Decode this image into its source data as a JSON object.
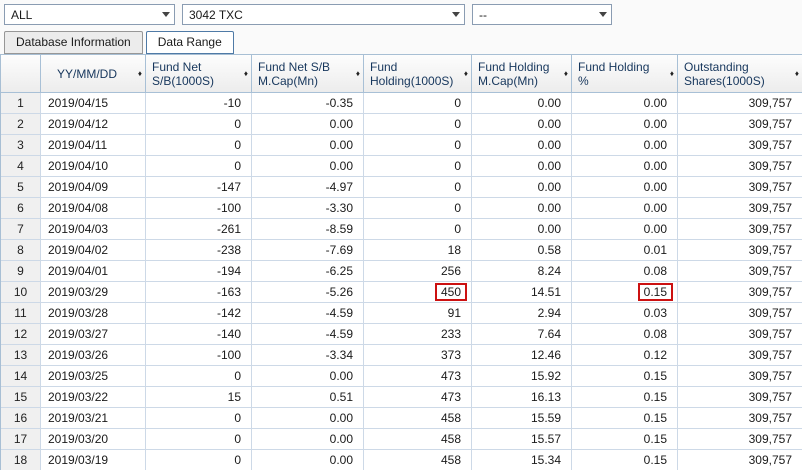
{
  "filters": {
    "dropdowns": [
      {
        "key": "market-filter",
        "value": "ALL"
      },
      {
        "key": "security-filter",
        "value": "3042 TXC"
      },
      {
        "key": "extra-filter",
        "value": "--"
      }
    ]
  },
  "tabs": [
    {
      "id": "database-information",
      "label": "Database Information",
      "active": false
    },
    {
      "id": "data-range",
      "label": "Data Range",
      "active": true
    }
  ],
  "icons": {
    "dropdown_arrow": "chevron-down-icon",
    "sort": "sort-diamond-icon",
    "sort_glyph": "♦"
  },
  "table": {
    "columns": [
      {
        "key": "row_number",
        "label": "",
        "sortable": false
      },
      {
        "key": "date",
        "label": "YY/MM/DD",
        "sortable": true
      },
      {
        "key": "fund_net_sb",
        "label": "Fund Net\nS/B(1000S)",
        "sortable": true
      },
      {
        "key": "fund_net_sb_mcap",
        "label": "Fund Net S/B\nM.Cap(Mn)",
        "sortable": true
      },
      {
        "key": "fund_holding",
        "label": "Fund\nHolding(1000S)",
        "sortable": true
      },
      {
        "key": "fund_holding_mcap",
        "label": "Fund Holding\nM.Cap(Mn)",
        "sortable": true
      },
      {
        "key": "fund_holding_pct",
        "label": "Fund Holding\n%",
        "sortable": true
      },
      {
        "key": "outstanding_shares",
        "label": "Outstanding\nShares(1000S)",
        "sortable": true
      }
    ],
    "rows": [
      [
        "1",
        "2019/04/15",
        "-10",
        "-0.35",
        "0",
        "0.00",
        "0.00",
        "309,757"
      ],
      [
        "2",
        "2019/04/12",
        "0",
        "0.00",
        "0",
        "0.00",
        "0.00",
        "309,757"
      ],
      [
        "3",
        "2019/04/11",
        "0",
        "0.00",
        "0",
        "0.00",
        "0.00",
        "309,757"
      ],
      [
        "4",
        "2019/04/10",
        "0",
        "0.00",
        "0",
        "0.00",
        "0.00",
        "309,757"
      ],
      [
        "5",
        "2019/04/09",
        "-147",
        "-4.97",
        "0",
        "0.00",
        "0.00",
        "309,757"
      ],
      [
        "6",
        "2019/04/08",
        "-100",
        "-3.30",
        "0",
        "0.00",
        "0.00",
        "309,757"
      ],
      [
        "7",
        "2019/04/03",
        "-261",
        "-8.59",
        "0",
        "0.00",
        "0.00",
        "309,757"
      ],
      [
        "8",
        "2019/04/02",
        "-238",
        "-7.69",
        "18",
        "0.58",
        "0.01",
        "309,757"
      ],
      [
        "9",
        "2019/04/01",
        "-194",
        "-6.25",
        "256",
        "8.24",
        "0.08",
        "309,757"
      ],
      [
        "10",
        "2019/03/29",
        "-163",
        "-5.26",
        "450",
        "14.51",
        "0.15",
        "309,757"
      ],
      [
        "11",
        "2019/03/28",
        "-142",
        "-4.59",
        "91",
        "2.94",
        "0.03",
        "309,757"
      ],
      [
        "12",
        "2019/03/27",
        "-140",
        "-4.59",
        "233",
        "7.64",
        "0.08",
        "309,757"
      ],
      [
        "13",
        "2019/03/26",
        "-100",
        "-3.34",
        "373",
        "12.46",
        "0.12",
        "309,757"
      ],
      [
        "14",
        "2019/03/25",
        "0",
        "0.00",
        "473",
        "15.92",
        "0.15",
        "309,757"
      ],
      [
        "15",
        "2019/03/22",
        "15",
        "0.51",
        "473",
        "16.13",
        "0.15",
        "309,757"
      ],
      [
        "16",
        "2019/03/21",
        "0",
        "0.00",
        "458",
        "15.59",
        "0.15",
        "309,757"
      ],
      [
        "17",
        "2019/03/20",
        "0",
        "0.00",
        "458",
        "15.57",
        "0.15",
        "309,757"
      ],
      [
        "18",
        "2019/03/19",
        "0",
        "0.00",
        "458",
        "15.34",
        "0.15",
        "309,757"
      ]
    ],
    "highlights": [
      {
        "row_index": 9,
        "col_index": 4
      },
      {
        "row_index": 9,
        "col_index": 6
      }
    ],
    "highlight_color": "#cc1111"
  }
}
